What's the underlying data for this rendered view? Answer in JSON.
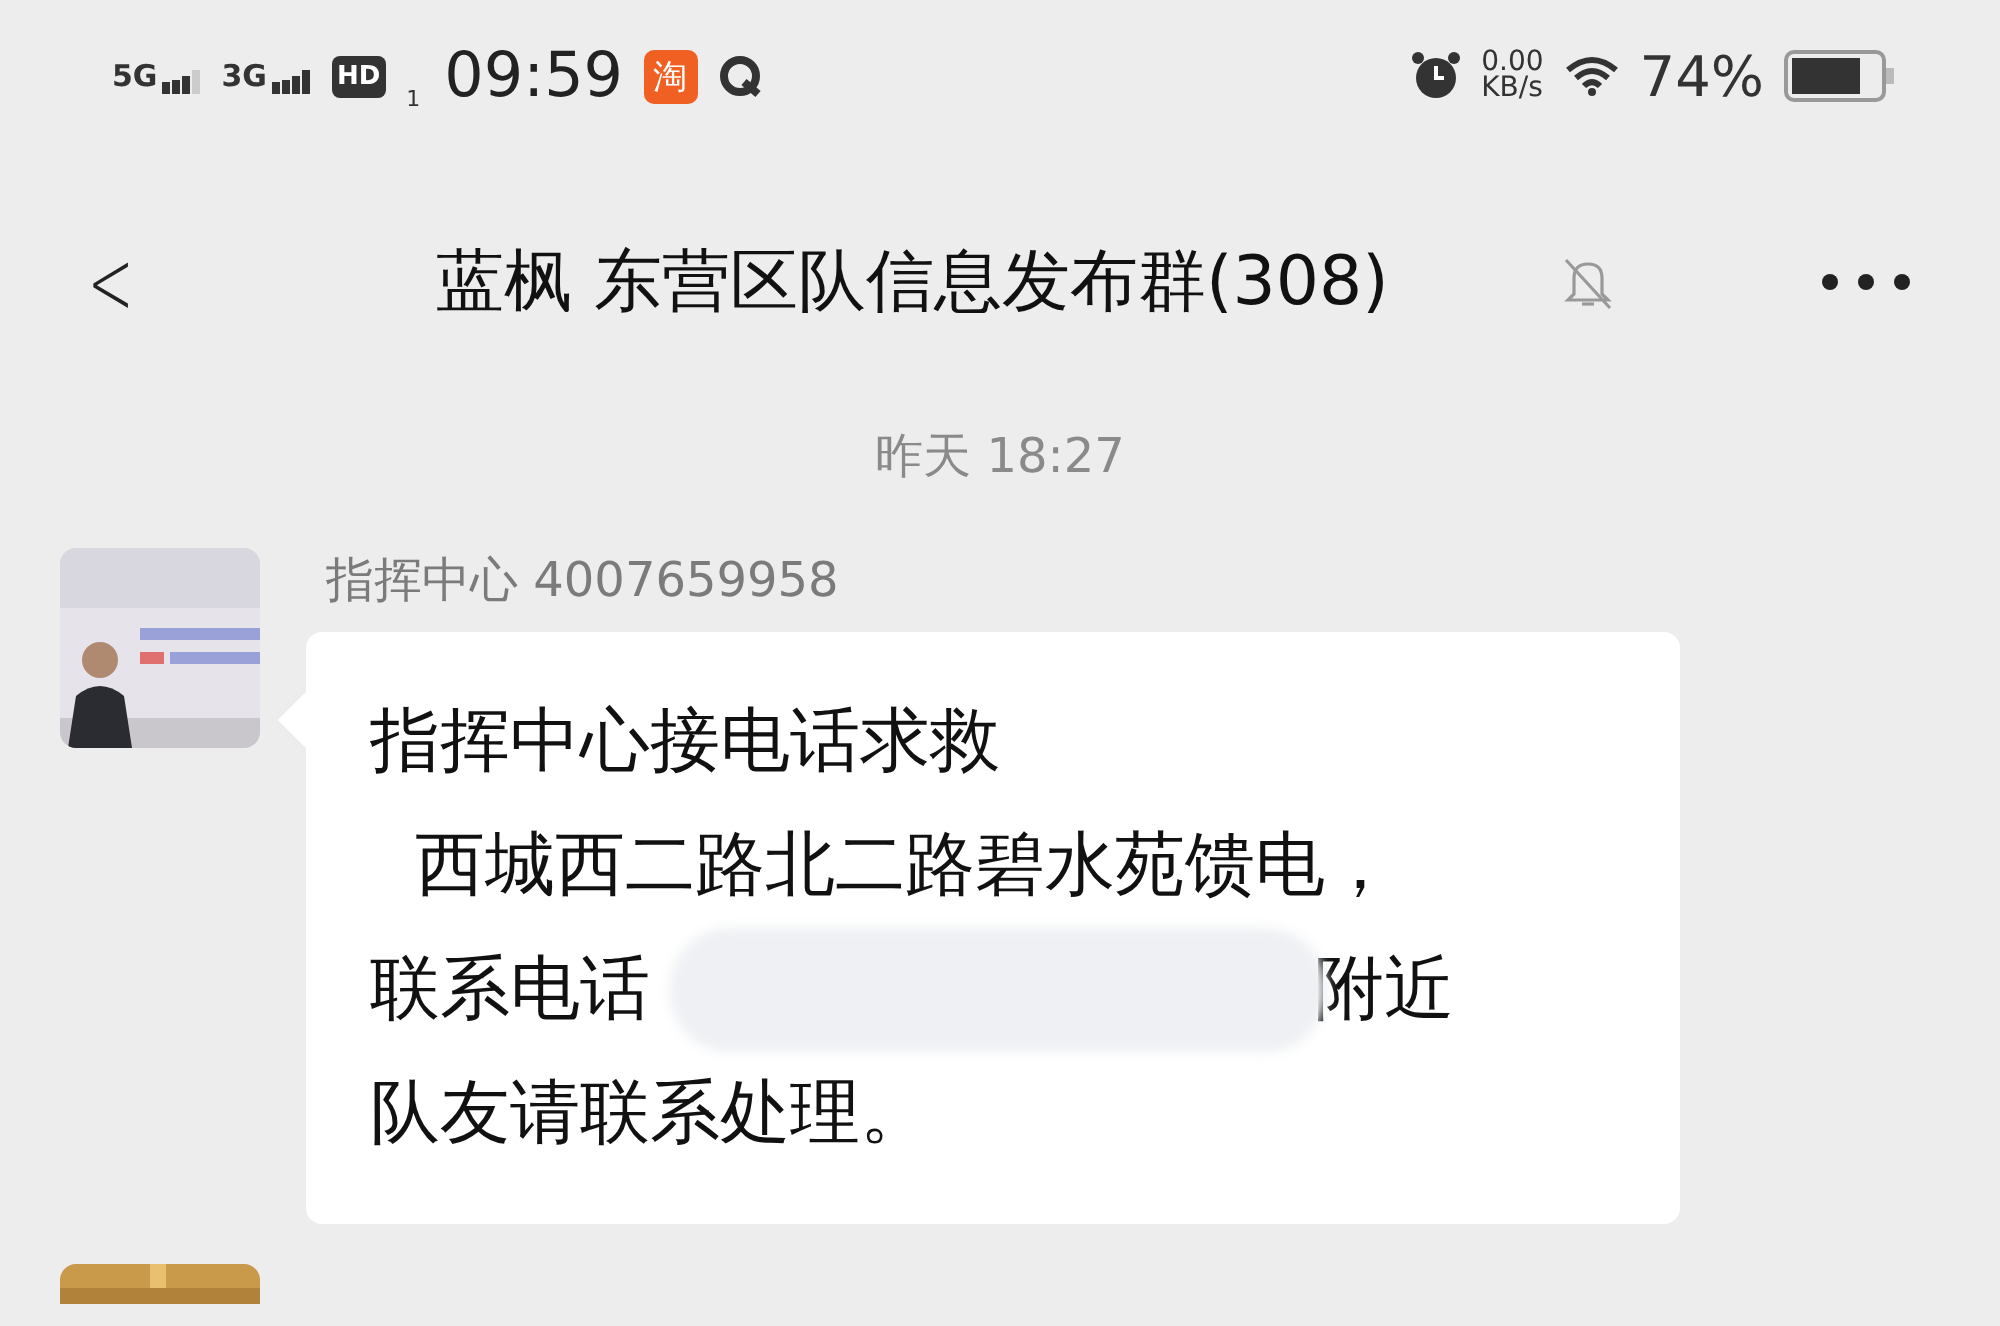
{
  "status_bar": {
    "networks": [
      {
        "label": "5G"
      },
      {
        "label": "3G"
      }
    ],
    "hd_badge": "HD",
    "sim_index": "1",
    "time": "09:59",
    "app_badge": "淘",
    "net_speed": {
      "value": "0.00",
      "unit": "KB/s"
    },
    "battery": "74%"
  },
  "header": {
    "back": "<",
    "title": "蓝枫 东营区队信息发布群(308)",
    "muted": true
  },
  "timestamp": "昨天 18:27",
  "messages": [
    {
      "sender": "指挥中心 4007659958",
      "lines": [
        {
          "kind": "text",
          "text": "指挥中心接电话求救"
        },
        {
          "kind": "text",
          "text": "  西城西二路北二路碧水苑馈电，"
        },
        {
          "kind": "redacted",
          "before": "联系电话",
          "after": "附近"
        },
        {
          "kind": "text",
          "text": "队友请联系处理。"
        }
      ]
    }
  ]
}
